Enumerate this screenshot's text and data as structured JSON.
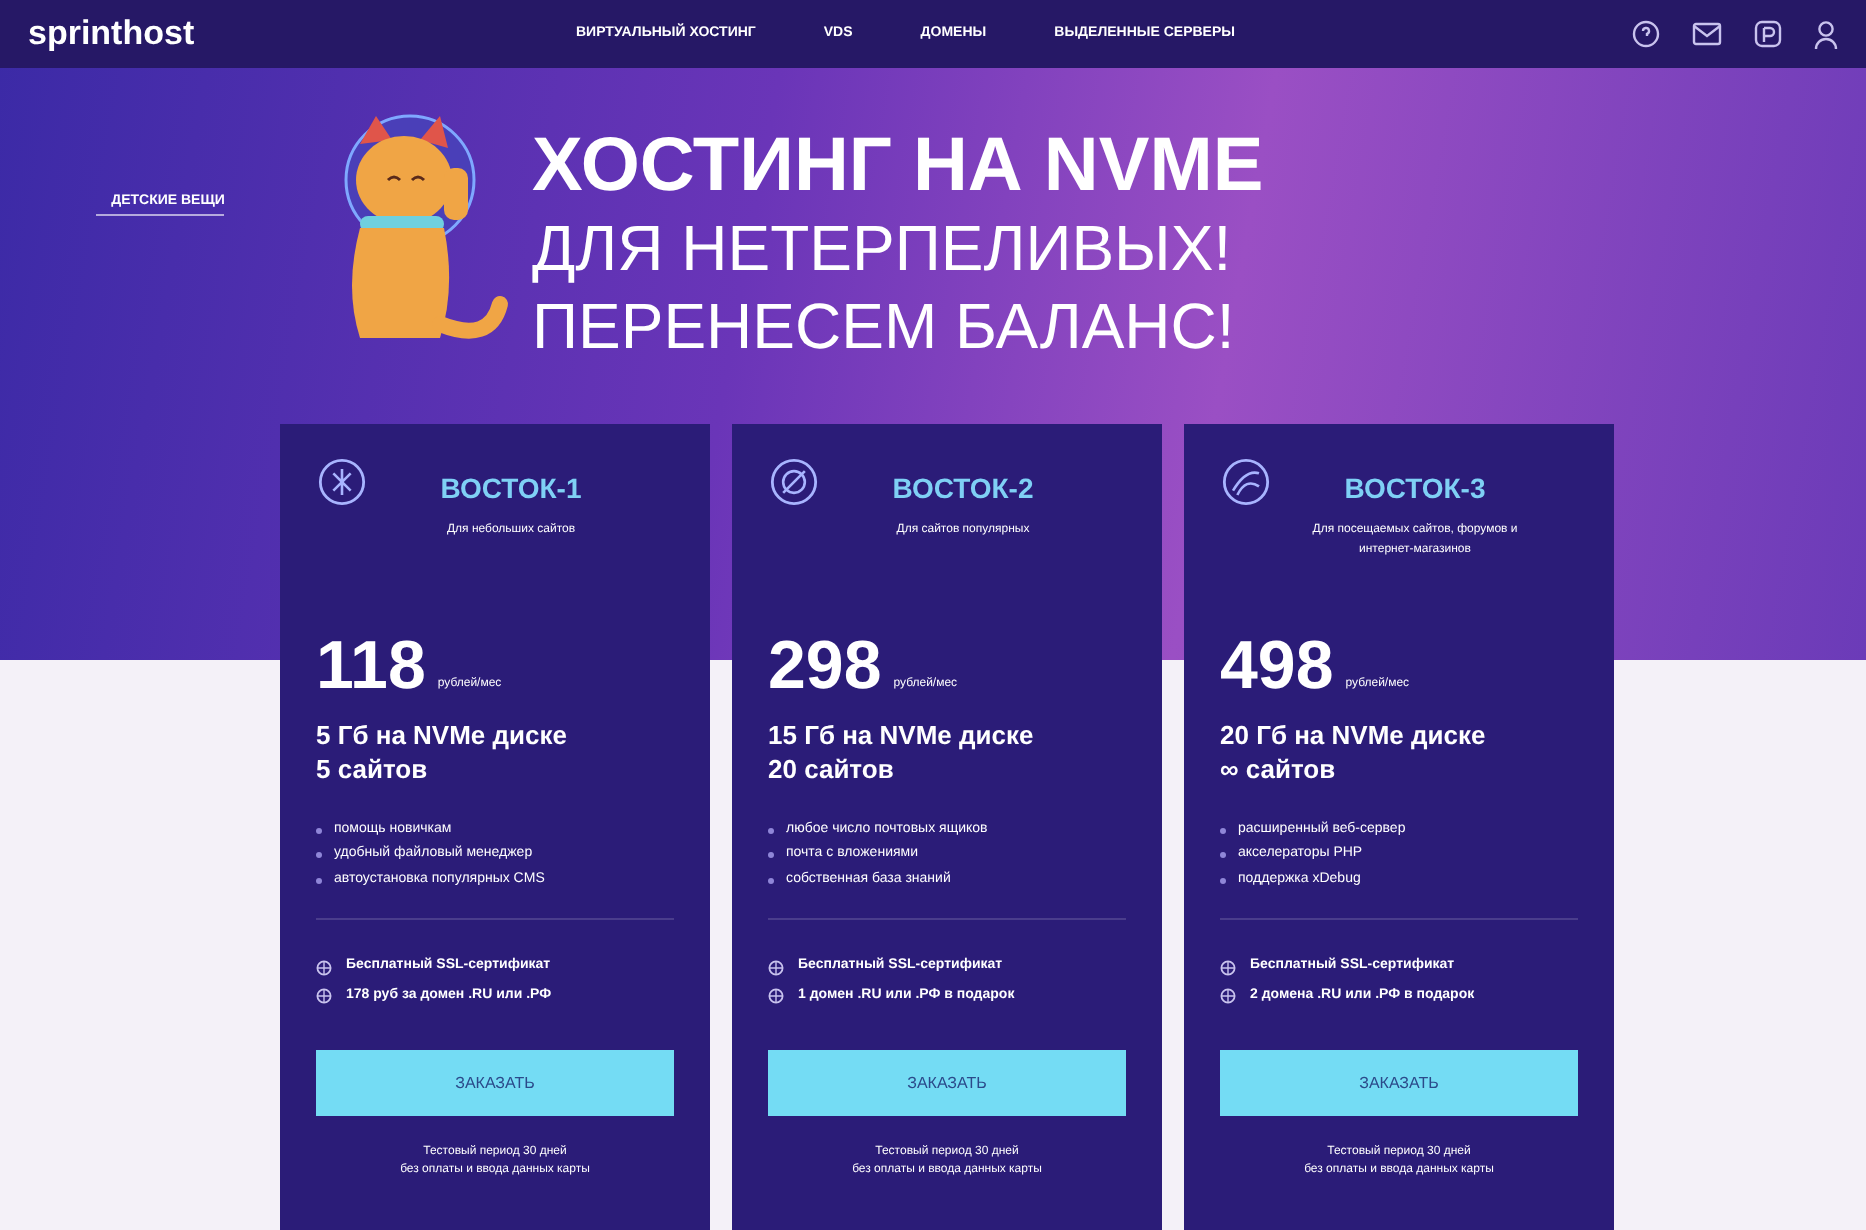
{
  "header": {
    "logo": "sprinthost",
    "nav": [
      {
        "label": "ВИРТУАЛЬНЫЙ ХОСТИНГ"
      },
      {
        "label": "VDS"
      },
      {
        "label": "ДОМЕНЫ"
      },
      {
        "label": "ВЫДЕЛЕННЫЕ СЕРВЕРЫ"
      }
    ]
  },
  "hero": {
    "tag": "ДЕТСКИЕ ВЕЩИ",
    "lines": [
      "ХОСТИНГ НА NVME",
      "ДЛЯ НЕТЕРПЕЛИВЫХ!",
      "ПЕРЕНЕСЕМ БАЛАНС!"
    ]
  },
  "plans": [
    {
      "name": "ВОСТОК-1",
      "subtitle": "Для небольших сайтов",
      "price": "118",
      "unit": "рублей/мес",
      "specs": [
        "5 Гб на NVMe диске",
        "5 сайтов"
      ],
      "features": [
        "помощь новичкам",
        "удобный файловый менеджер",
        "автоустановка популярных CMS"
      ],
      "extras": [
        "Бесплатный SSL-сертификат",
        "178 руб за домен .RU или .РФ"
      ],
      "button": "ЗАКАЗАТЬ",
      "note": [
        "Тестовый период 30 дней",
        "без оплаты и ввода данных карты"
      ]
    },
    {
      "name": "ВОСТОК-2",
      "subtitle": "Для сайтов популярных",
      "price": "298",
      "unit": "рублей/мес",
      "specs": [
        "15 Гб на NVMe диске",
        "20 сайтов"
      ],
      "features": [
        "любое число почтовых ящиков",
        "почта с вложениями",
        "собственная база знаний"
      ],
      "extras": [
        "Бесплатный SSL-сертификат",
        "1 домен .RU или .РФ в подарок"
      ],
      "button": "ЗАКАЗАТЬ",
      "note": [
        "Тестовый период 30 дней",
        "без оплаты и ввода данных карты"
      ]
    },
    {
      "name": "ВОСТОК-3",
      "subtitle": "Для посещаемых сайтов, форумов и интернет-магазинов",
      "price": "498",
      "unit": "рублей/мес",
      "specs": [
        "20 Гб на NVMe диске",
        "∞ сайтов"
      ],
      "features": [
        "расширенный веб-сервер",
        "акселераторы PHP",
        "поддержка xDebug"
      ],
      "extras": [
        "Бесплатный SSL-сертификат",
        "2 домена .RU или .РФ в подарок"
      ],
      "button": "ЗАКАЗАТЬ",
      "note": [
        "Тестовый период 30 дней",
        "без оплаты и ввода данных карты"
      ]
    }
  ]
}
